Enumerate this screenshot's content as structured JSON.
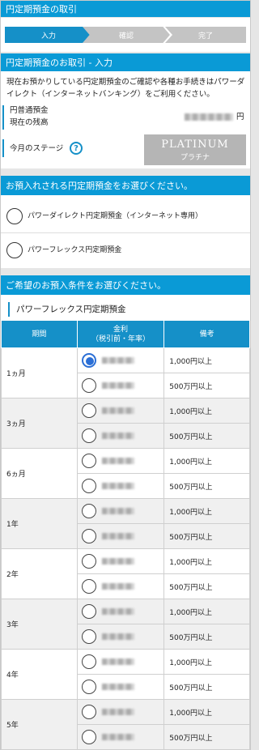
{
  "top_header": {
    "title": "円定期預金の取引"
  },
  "steps": [
    {
      "label": "入力",
      "active": true
    },
    {
      "label": "確認",
      "active": false
    },
    {
      "label": "完了",
      "active": false
    }
  ],
  "transaction": {
    "header": "円定期預金のお取引 - 入力",
    "description_line1": "現在お預かりしている円定期預金のご確認や各種お手続きはパワーダ",
    "description_line2": "イレクト（インターネットバンキング）をご利用ください。",
    "ordinary_label": "円普通預金",
    "balance_label": "現在の残高",
    "balance_unit": "円",
    "stage_label": "今月のステージ",
    "help_icon": "question-circle-icon",
    "stage_badge_main": "PLATINUM",
    "stage_badge_sub": "プラチナ"
  },
  "deposit_select": {
    "header": "お預入れされる円定期預金をお選びください。",
    "options": [
      {
        "label": "パワーダイレクト円定期預金（インターネット専用）",
        "selected": false
      },
      {
        "label": "パワーフレックス円定期預金",
        "selected": false
      }
    ]
  },
  "conditions": {
    "header": "ご希望のお預入条件をお選びください。",
    "product_title": "パワーフレックス円定期預金",
    "table_headers": {
      "term": "期間",
      "rate_line1": "金利",
      "rate_line2": "（税引前・年率）",
      "note": "備考"
    },
    "rows": [
      {
        "term": "1ヵ月",
        "notes": [
          "1,000円以上",
          "500万円以上"
        ],
        "selected": [
          true,
          false
        ]
      },
      {
        "term": "3ヵ月",
        "notes": [
          "1,000円以上",
          "500万円以上"
        ],
        "selected": [
          false,
          false
        ]
      },
      {
        "term": "6ヵ月",
        "notes": [
          "1,000円以上",
          "500万円以上"
        ],
        "selected": [
          false,
          false
        ]
      },
      {
        "term": "1年",
        "notes": [
          "1,000円以上",
          "500万円以上"
        ],
        "selected": [
          false,
          false
        ]
      },
      {
        "term": "2年",
        "notes": [
          "1,000円以上",
          "500万円以上"
        ],
        "selected": [
          false,
          false
        ]
      },
      {
        "term": "3年",
        "notes": [
          "1,000円以上",
          "500万円以上"
        ],
        "selected": [
          false,
          false
        ]
      },
      {
        "term": "4年",
        "notes": [
          "1,000円以上",
          "500万円以上"
        ],
        "selected": [
          false,
          false
        ]
      },
      {
        "term": "5年",
        "notes": [
          "1,000円以上",
          "500万円以上"
        ],
        "selected": [
          false,
          false
        ]
      }
    ]
  },
  "colors": {
    "accent": "#0a9ad6",
    "step_active": "#1590c8",
    "step_inactive": "#c4c4c4",
    "radio_selected": "#2b6fd6"
  }
}
